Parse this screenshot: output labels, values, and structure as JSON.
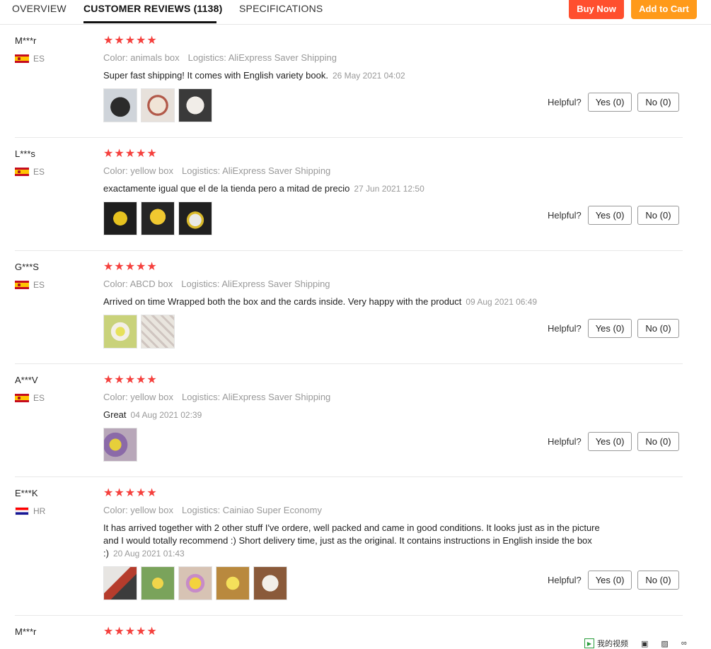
{
  "tabs": [
    {
      "label": "OVERVIEW"
    },
    {
      "label": "CUSTOMER REVIEWS (1138)"
    },
    {
      "label": "SPECIFICATIONS"
    }
  ],
  "actions": {
    "buy_now": "Buy Now",
    "add_to_cart": "Add to Cart"
  },
  "helpful_label": "Helpful?",
  "reviews": [
    {
      "user": "M***r",
      "country": "ES",
      "flag": "es",
      "stars": "★★★★★",
      "color": "Color: animals box",
      "logistics": "Logistics: AliExpress Saver Shipping",
      "text": "Super fast shipping! It comes with English variety book.",
      "date": "26 May 2021 04:02",
      "yes": "Yes (0)",
      "no": "No (0)",
      "thumbs": 3
    },
    {
      "user": "L***s",
      "country": "ES",
      "flag": "es",
      "stars": "★★★★★",
      "color": "Color: yellow box",
      "logistics": "Logistics: AliExpress Saver Shipping",
      "text": "exactamente igual que el de la tienda pero a mitad de precio",
      "date": "27 Jun 2021 12:50",
      "yes": "Yes (0)",
      "no": "No (0)",
      "thumbs": 3
    },
    {
      "user": "G***S",
      "country": "ES",
      "flag": "es",
      "stars": "★★★★★",
      "color": "Color: ABCD box",
      "logistics": "Logistics: AliExpress Saver Shipping",
      "text": "Arrived on time Wrapped both the box and the cards inside. Very happy with the product",
      "date": "09 Aug 2021 06:49",
      "yes": "Yes (0)",
      "no": "No (0)",
      "thumbs": 2
    },
    {
      "user": "A***V",
      "country": "ES",
      "flag": "es",
      "stars": "★★★★★",
      "color": "Color: yellow box",
      "logistics": "Logistics: AliExpress Saver Shipping",
      "text": "Great",
      "date": "04 Aug 2021 02:39",
      "yes": "Yes (0)",
      "no": "No (0)",
      "thumbs": 1
    },
    {
      "user": "E***K",
      "country": "HR",
      "flag": "hr",
      "stars": "★★★★★",
      "color": "Color: yellow box",
      "logistics": "Logistics: Cainiao Super Economy",
      "text": "It has arrived together with 2 other stuff I've ordere, well packed and came in good conditions. It looks just as in the picture and I would totally recommend :) Short delivery time, just as the original. It contains instructions in English inside the box :)",
      "date": "20 Aug 2021 01:43",
      "yes": "Yes (0)",
      "no": "No (0)",
      "thumbs": 5
    },
    {
      "user": "M***r",
      "stars": "★★★★★"
    }
  ],
  "footer": {
    "video_label": "我的视频"
  }
}
